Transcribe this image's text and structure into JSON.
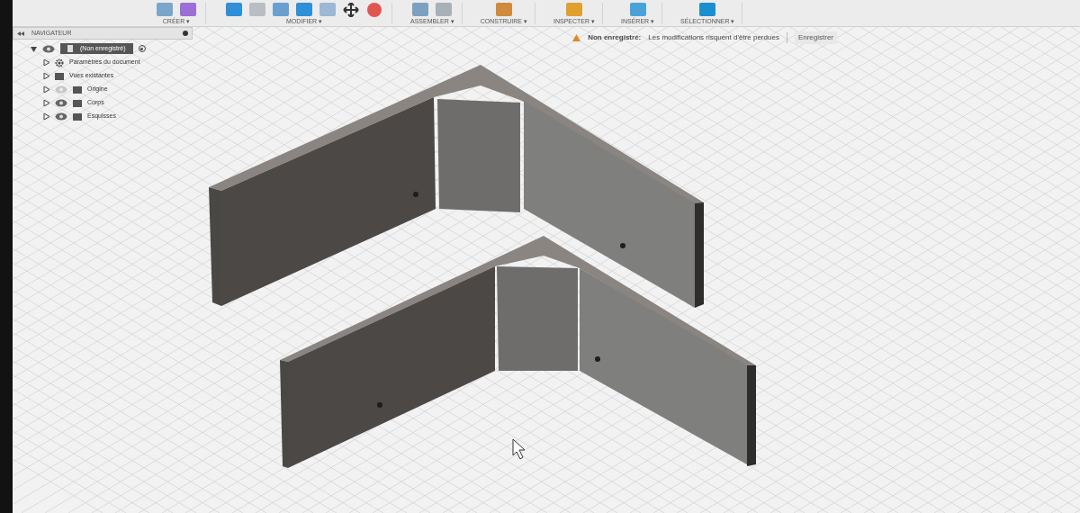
{
  "toolbar": {
    "groups": [
      {
        "label": "CRÉER ▾"
      },
      {
        "label": "MODIFIER ▾"
      },
      {
        "label": "ASSEMBLER ▾"
      },
      {
        "label": "CONSTRUIRE ▾"
      },
      {
        "label": "INSPECTER ▾"
      },
      {
        "label": "INSÉRER ▾"
      },
      {
        "label": "SÉLECTIONNER ▾"
      }
    ]
  },
  "navigator": {
    "title": "NAVIGATEUR",
    "root": {
      "label": "(Non enregistré)",
      "expanded": true,
      "children": [
        {
          "label": "Paramètres du document",
          "kind": "gear"
        },
        {
          "label": "Vues existantes",
          "kind": "folder"
        },
        {
          "label": "Origine",
          "kind": "folder",
          "visible": false
        },
        {
          "label": "Corps",
          "kind": "folder",
          "visible": true
        },
        {
          "label": "Esquisses",
          "kind": "folder",
          "visible": true
        }
      ]
    }
  },
  "notice": {
    "status": "Non enregistré:",
    "message": "Les modifications risquent d'être perdues",
    "button": "Enregistrer"
  }
}
